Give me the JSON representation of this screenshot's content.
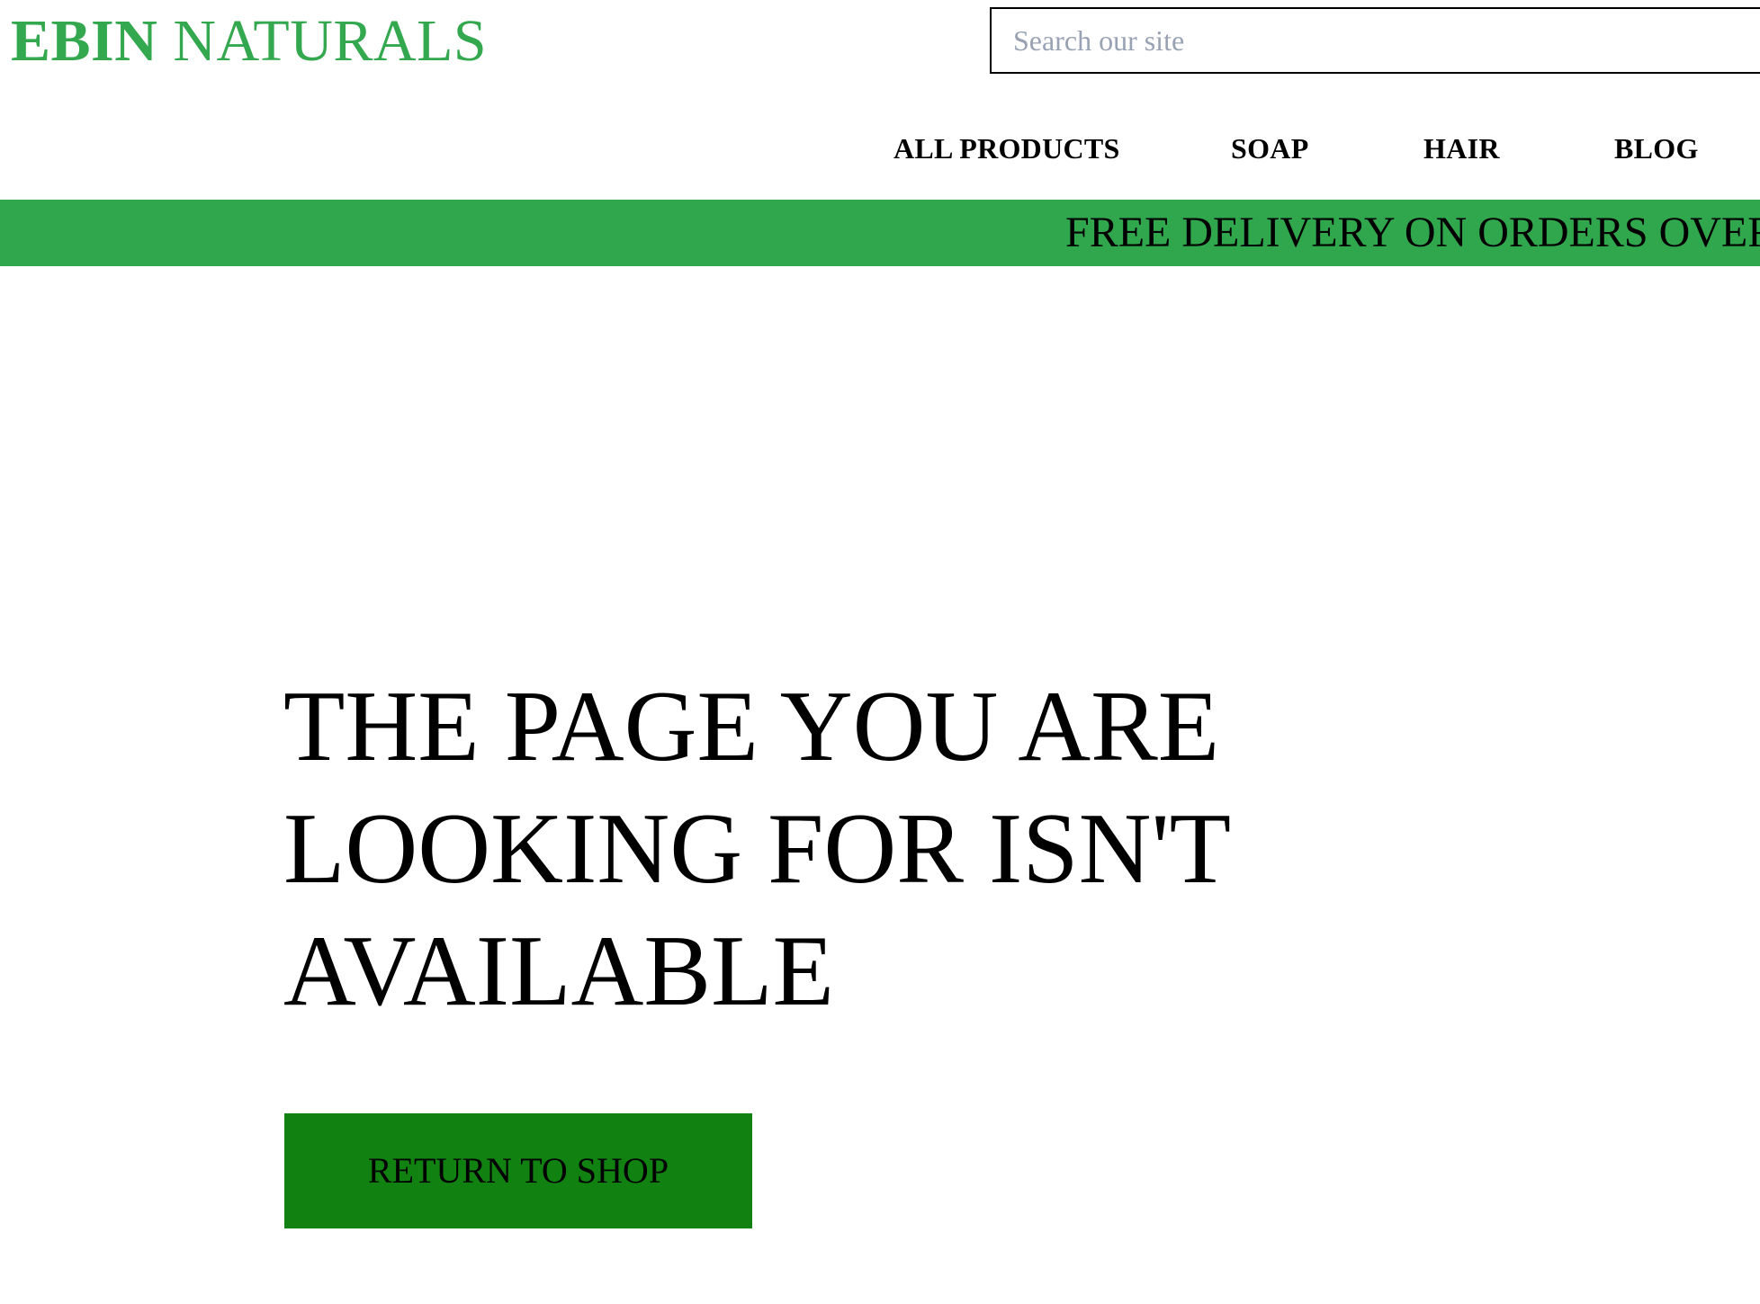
{
  "header": {
    "brand_strong": "EBIN",
    "brand_rest": "NATURALS"
  },
  "search": {
    "placeholder": "Search our site",
    "value": ""
  },
  "nav": {
    "items": [
      {
        "label": "ALL PRODUCTS"
      },
      {
        "label": "SOAP"
      },
      {
        "label": "HAIR"
      },
      {
        "label": "BLOG"
      }
    ]
  },
  "promo": {
    "text": "FREE DELIVERY ON ORDERS OVER"
  },
  "main": {
    "heading": "THE PAGE YOU ARE LOOKING FOR ISN'T AVAILABLE",
    "button_label": "RETURN TO SHOP"
  },
  "colors": {
    "brand_green": "#33a84f",
    "banner_green": "#31a74d",
    "button_green": "#118112",
    "placeholder_gray": "#98a2b3"
  }
}
